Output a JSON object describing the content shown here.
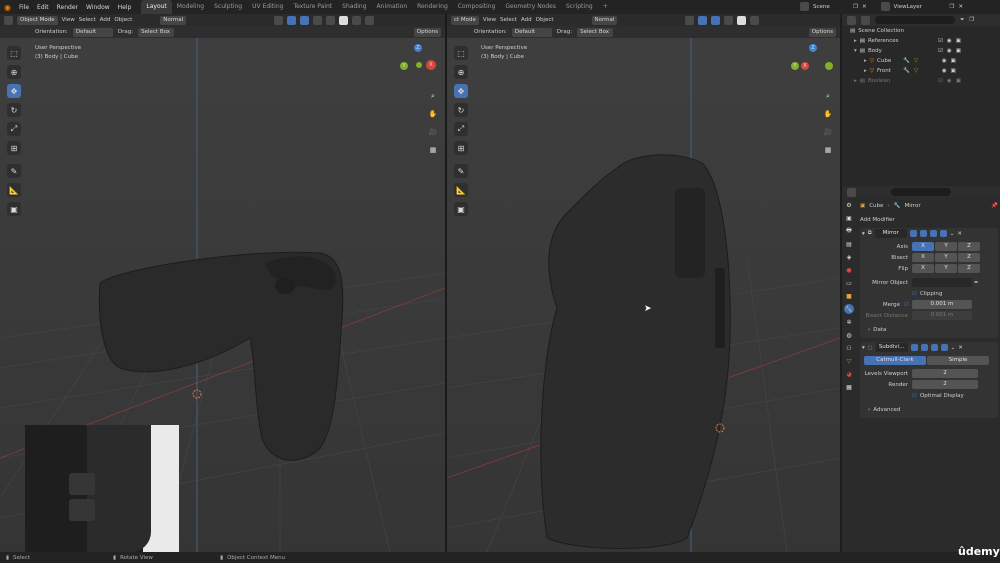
{
  "menu": [
    "File",
    "Edit",
    "Render",
    "Window",
    "Help"
  ],
  "workspaces": [
    "Layout",
    "Modeling",
    "Sculpting",
    "UV Editing",
    "Texture Paint",
    "Shading",
    "Animation",
    "Rendering",
    "Compositing",
    "Geometry Nodes",
    "Scripting",
    "+"
  ],
  "scene": "Scene",
  "view_layer": "ViewLayer",
  "left_viewport": {
    "mode": "Object Mode",
    "menus": [
      "View",
      "Select",
      "Add",
      "Object"
    ],
    "transform": "Normal",
    "orientation_label": "Orientation:",
    "orientation_value": "Default",
    "drag_label": "Drag:",
    "drag_value": "Select Box",
    "options": "Options",
    "view_name": "User Perspective",
    "object_info": "(3) Body | Cube"
  },
  "right_viewport": {
    "mode": "ct Mode",
    "menus": [
      "View",
      "Select",
      "Add",
      "Object"
    ],
    "transform": "Normal",
    "orientation_label": "Orientation:",
    "orientation_value": "Default",
    "drag_label": "Drag:",
    "drag_value": "Select Box",
    "options": "Options",
    "view_name": "User Perspective",
    "object_info": "(3) Body | Cube"
  },
  "gizmo": {
    "z": "Z",
    "y": "Y",
    "x": "X"
  },
  "outliner": {
    "items": [
      {
        "label": "Scene Collection"
      },
      {
        "label": "References"
      },
      {
        "label": "Body"
      },
      {
        "label": "Cube"
      },
      {
        "label": "Front"
      },
      {
        "label": "Boolean"
      }
    ]
  },
  "properties": {
    "breadcrumb_object": "Cube",
    "breadcrumb_modifier": "Mirror",
    "add_modifier": "Add Modifier",
    "mirror": {
      "name": "Mirror",
      "axis_label": "Axis",
      "bisect_label": "Bisect",
      "flip_label": "Flip",
      "axes": [
        "X",
        "Y",
        "Z"
      ],
      "mirror_object_label": "Mirror Object",
      "clipping_label": "Clipping",
      "merge_label": "Merge",
      "merge_value": "0.001 m",
      "bisect_distance_label": "Bisect Distance",
      "bisect_distance_value": "0.001 m",
      "data_label": "Data"
    },
    "subdivision": {
      "name": "Subdivi...",
      "catmull": "Catmull-Clark",
      "simple": "Simple",
      "levels_label": "Levels Viewport",
      "levels_value": "2",
      "render_label": "Render",
      "render_value": "2",
      "optimal_label": "Optimal Display",
      "advanced_label": "Advanced"
    }
  },
  "status": {
    "select": "Select",
    "rotate": "Rotate View",
    "context": "Object Context Menu"
  },
  "watermark": "ûdemy",
  "colors": {
    "accent": "#4772b3",
    "gizmo_x": "#d8453b",
    "gizmo_y": "#7fb228",
    "gizmo_z": "#3f83d3"
  }
}
